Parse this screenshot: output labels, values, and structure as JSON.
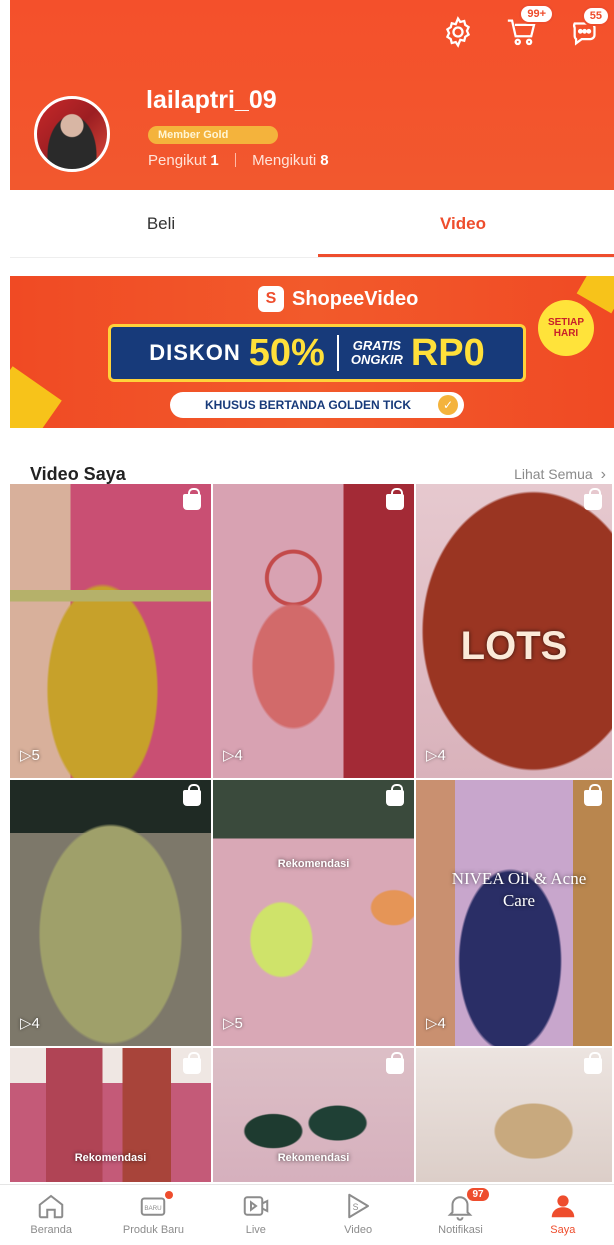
{
  "header": {
    "cart_badge": "99+",
    "chat_badge": "55",
    "username": "lailaptri_09",
    "member_label": "Member Gold",
    "followers_label": "Pengikut",
    "followers_count": "1",
    "following_label": "Mengikuti",
    "following_count": "8"
  },
  "tabs": [
    {
      "label": "Beli",
      "active": false
    },
    {
      "label": "Video",
      "active": true
    }
  ],
  "banner": {
    "brand": "ShopeeVideo",
    "diskon": "DISKON",
    "percent": "50%",
    "gratis": "GRATIS",
    "ongkir": "ONGKIR",
    "rp0": "RP0",
    "setiap": "SETIAP",
    "hari": "HARI",
    "khusus": "KHUSUS BERTANDA GOLDEN TICK"
  },
  "section": {
    "title": "Video Saya",
    "see_all": "Lihat Semua"
  },
  "videos": [
    {
      "plays": "5",
      "overlay": ""
    },
    {
      "plays": "4",
      "overlay": ""
    },
    {
      "plays": "4",
      "overlay": "LOTS"
    },
    {
      "plays": "4",
      "overlay": ""
    },
    {
      "plays": "5",
      "overlay": "Rekomendasi"
    },
    {
      "plays": "4",
      "overlay": "NIVEA Oil & Acne Care"
    },
    {
      "plays": "",
      "overlay": "Rekomendasi"
    },
    {
      "plays": "",
      "overlay": "Rekomendasi"
    },
    {
      "plays": "",
      "overlay": ""
    }
  ],
  "bottom_nav": [
    {
      "label": "Beranda",
      "icon": "home-icon",
      "active": false
    },
    {
      "label": "Produk Baru",
      "icon": "new-product-icon",
      "active": false,
      "dot": true
    },
    {
      "label": "Live",
      "icon": "live-icon",
      "active": false
    },
    {
      "label": "Video",
      "icon": "video-icon",
      "active": false
    },
    {
      "label": "Notifikasi",
      "icon": "bell-icon",
      "active": false,
      "badge": "97"
    },
    {
      "label": "Saya",
      "icon": "person-icon",
      "active": true
    }
  ],
  "colors": {
    "brand": "#ee4d2d",
    "header_bg": "#f4502b",
    "member_badge": "#f4b33c",
    "promo_navy": "#173a7a",
    "promo_yellow": "#ffe03a"
  }
}
